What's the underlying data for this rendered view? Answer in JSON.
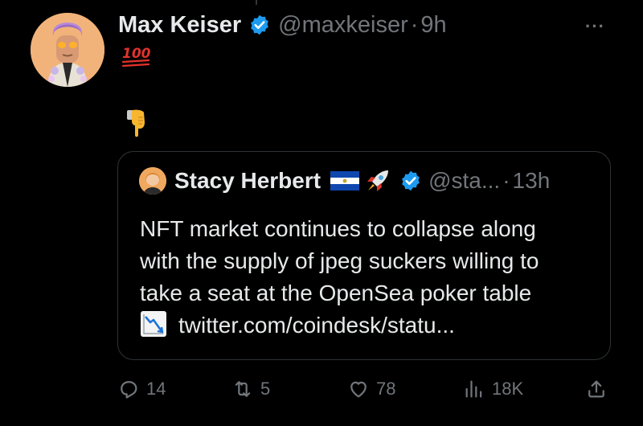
{
  "tweet": {
    "author_name": "Max Keiser",
    "author_handle": "@maxkeiser",
    "separator": "·",
    "time": "9h",
    "more_label": "···",
    "body_emojis": [
      "100-emoji",
      "pointing-down-emoji"
    ]
  },
  "quoted_tweet": {
    "author_name": "Stacy Herbert",
    "name_emojis": [
      "el-salvador-flag",
      "rocket-emoji"
    ],
    "author_handle": "@sta...",
    "separator": "·",
    "time": "13h",
    "text_lines": [
      "NFT market continues to collapse along",
      "with the supply of jpeg suckers willing to",
      "take a seat at the OpenSea poker table"
    ],
    "link_text": "twitter.com/coindesk/statu..."
  },
  "actions": {
    "replies": "14",
    "retweets": "5",
    "likes": "78",
    "views": "18K"
  },
  "colors": {
    "background": "#000000",
    "text": "#e7e9ea",
    "muted": "#71767b",
    "verified": "#1d9bf0",
    "border": "#2f3336"
  }
}
